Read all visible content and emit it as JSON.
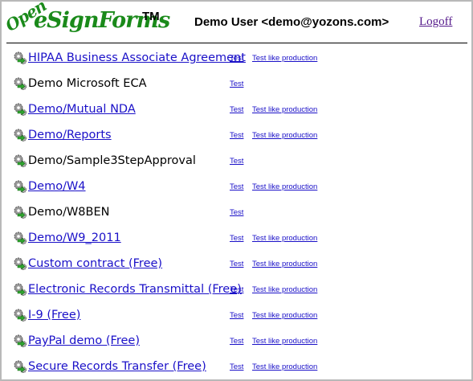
{
  "header": {
    "logo_open": "Open",
    "logo_main": "eSignForms",
    "logo_tm": "TM",
    "user_label": "Demo User <demo@yozons.com>",
    "logoff_label": "Logoff"
  },
  "packages": [
    {
      "name": "HIPAA Business Associate Agreement",
      "linked": true,
      "has_gear": true,
      "test": "Test",
      "production": "Test like production"
    },
    {
      "name": "Demo Microsoft ECA",
      "linked": false,
      "has_gear": true,
      "test": "Test",
      "production": ""
    },
    {
      "name": "Demo/Mutual NDA",
      "linked": true,
      "has_gear": true,
      "test": "Test",
      "production": "Test like production"
    },
    {
      "name": "Demo/Reports",
      "linked": true,
      "has_gear": true,
      "test": "Test",
      "production": "Test like production"
    },
    {
      "name": "Demo/Sample3StepApproval",
      "linked": false,
      "has_gear": true,
      "test": "Test",
      "production": ""
    },
    {
      "name": "Demo/W4",
      "linked": true,
      "has_gear": true,
      "test": "Test",
      "production": "Test like production"
    },
    {
      "name": "Demo/W8BEN",
      "linked": false,
      "has_gear": true,
      "test": "Test",
      "production": ""
    },
    {
      "name": "Demo/W9_2011",
      "linked": true,
      "has_gear": true,
      "test": "Test",
      "production": "Test like production"
    },
    {
      "name": "Custom contract (Free)",
      "linked": true,
      "has_gear": true,
      "test": "Test",
      "production": "Test like production"
    },
    {
      "name": "Electronic Records Transmittal (Free)",
      "linked": true,
      "has_gear": true,
      "test": "Test",
      "production": "Test like production"
    },
    {
      "name": "I-9 (Free)",
      "linked": true,
      "has_gear": true,
      "test": "Test",
      "production": "Test like production"
    },
    {
      "name": "PayPal demo (Free)",
      "linked": true,
      "has_gear": true,
      "test": "Test",
      "production": "Test like production"
    },
    {
      "name": "Secure Records Transfer (Free)",
      "linked": true,
      "has_gear": true,
      "test": "Test",
      "production": "Test like production"
    }
  ],
  "colors": {
    "link": "#1a10c8",
    "visited": "#551a8b",
    "logo_green": "#1a8a1a",
    "frame_border": "#b9b9b9"
  },
  "icons": {
    "row_icon": "gear-icon"
  }
}
